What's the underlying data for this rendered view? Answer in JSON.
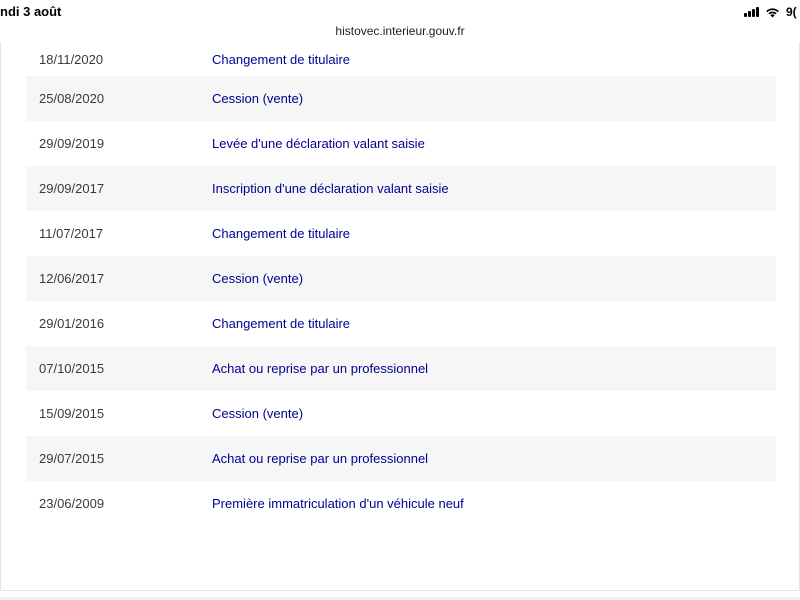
{
  "status_bar": {
    "date": "ndi 3 août",
    "battery": "9("
  },
  "url": "histovec.interieur.gouv.fr",
  "history": [
    {
      "date": "18/11/2020",
      "event": "Changement de titulaire"
    },
    {
      "date": "25/08/2020",
      "event": "Cession (vente)"
    },
    {
      "date": "29/09/2019",
      "event": "Levée d'une déclaration valant saisie"
    },
    {
      "date": "29/09/2017",
      "event": "Inscription d'une déclaration valant saisie"
    },
    {
      "date": "11/07/2017",
      "event": "Changement de titulaire"
    },
    {
      "date": "12/06/2017",
      "event": "Cession (vente)"
    },
    {
      "date": "29/01/2016",
      "event": "Changement de titulaire"
    },
    {
      "date": "07/10/2015",
      "event": "Achat ou reprise par un professionnel"
    },
    {
      "date": "15/09/2015",
      "event": "Cession (vente)"
    },
    {
      "date": "29/07/2015",
      "event": "Achat ou reprise par un professionnel"
    },
    {
      "date": "23/06/2009",
      "event": "Première immatriculation d'un véhicule neuf"
    }
  ],
  "colors": {
    "link": "#000091",
    "row_alt": "#f6f6f6"
  }
}
